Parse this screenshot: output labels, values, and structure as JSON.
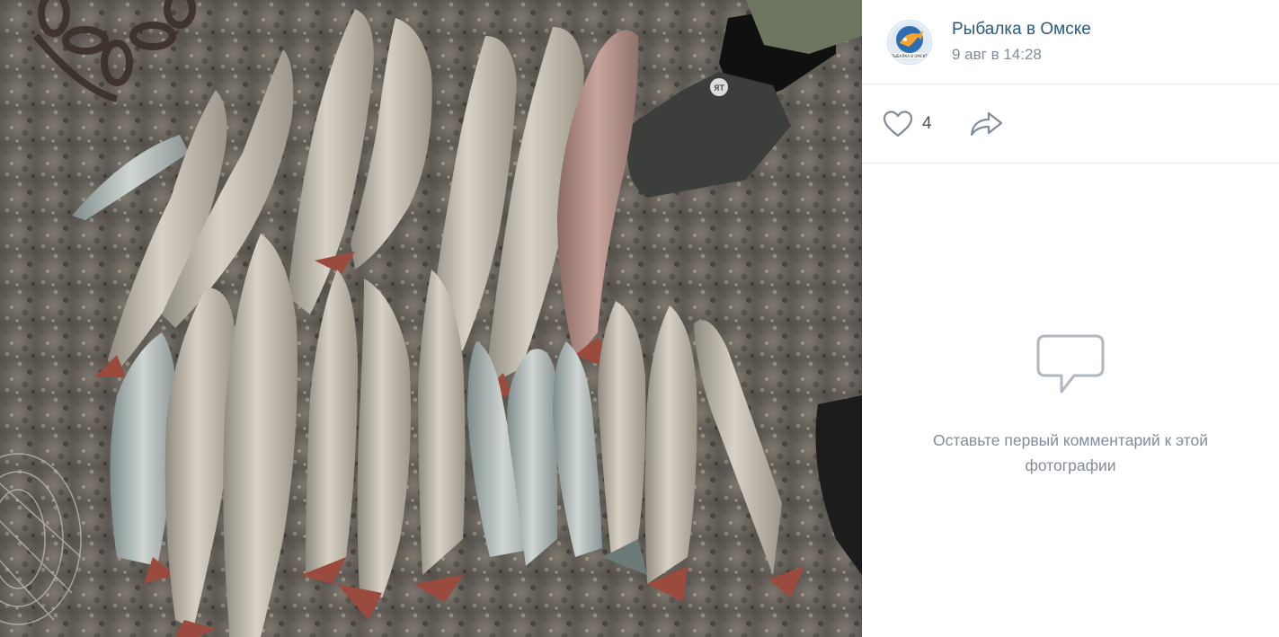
{
  "post": {
    "author": "Рыбалка в Омске",
    "date": "9 авг в 14:28",
    "avatar_icon": "fishing-club-logo",
    "avatar_caption": "РЫБАЛКА В ОМСКЕ"
  },
  "actions": {
    "likes": "4",
    "like_icon": "heart-icon",
    "share_icon": "share-arrow-icon"
  },
  "comments": {
    "empty_icon": "speech-bubble-icon",
    "empty_text": "Оставьте первый комментарий к этой фотографии"
  },
  "photo": {
    "subject": "catch of pike fish laid on gravel",
    "boot_logo": "ЯТ"
  },
  "colors": {
    "link": "#2a5885",
    "secondary_text": "#818c99",
    "divider": "#e7e8ec",
    "icon": "#818c99"
  }
}
